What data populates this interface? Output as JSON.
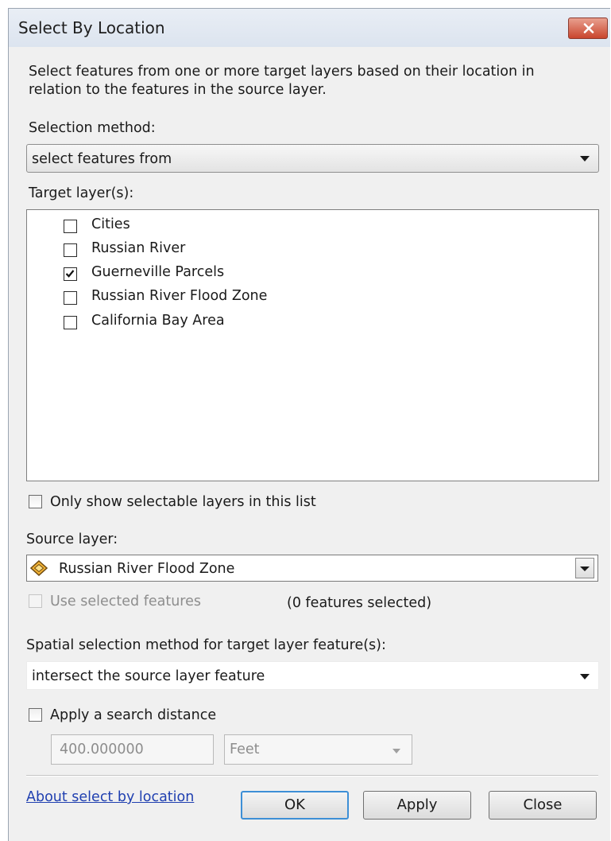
{
  "window": {
    "title": "Select By Location",
    "close_icon": "close-x-icon"
  },
  "description": "Select features from one or more target layers based on their location in relation to the features in the source layer.",
  "selection_method": {
    "label": "Selection method:",
    "value": "select features from"
  },
  "target_layers": {
    "label": "Target layer(s):",
    "items": [
      {
        "label": "Cities",
        "checked": false
      },
      {
        "label": "Russian River",
        "checked": false
      },
      {
        "label": "Guerneville Parcels",
        "checked": true
      },
      {
        "label": "Russian River Flood Zone",
        "checked": false
      },
      {
        "label": "California Bay Area",
        "checked": false
      }
    ]
  },
  "only_selectable": {
    "label": "Only show selectable layers in this list",
    "checked": false
  },
  "source_layer": {
    "label": "Source layer:",
    "value": "Russian River Flood Zone",
    "icon": "polygon-layer-icon"
  },
  "use_selected": {
    "label": "Use selected features",
    "checked": false,
    "enabled": false,
    "count_text": "(0 features selected)"
  },
  "spatial_method": {
    "label": "Spatial selection method for target layer feature(s):",
    "value": "intersect the source layer feature"
  },
  "search_distance": {
    "label": "Apply a search distance",
    "checked": false,
    "value": "400.000000",
    "units": "Feet"
  },
  "footer": {
    "help_link": "About select by location",
    "ok_label": "OK",
    "apply_label": "Apply",
    "close_label": "Close"
  },
  "colors": {
    "title_bar": "#dce4ef",
    "close_button": "#c9452d",
    "link": "#1f3fb0",
    "dialog_bg": "#f0f0f0"
  }
}
